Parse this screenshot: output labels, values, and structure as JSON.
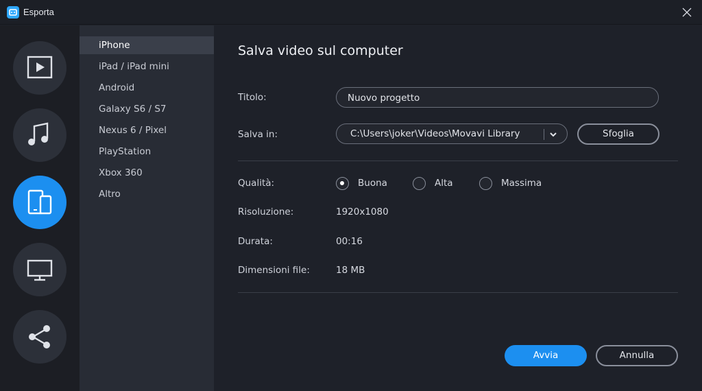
{
  "window": {
    "title": "Esporta"
  },
  "rail": {
    "items": [
      "video-icon",
      "music-icon",
      "devices-icon",
      "monitor-icon",
      "share-icon"
    ],
    "active": "devices-icon",
    "accent": "#1c8ff0"
  },
  "devices": {
    "items": [
      "iPhone",
      "iPad / iPad mini",
      "Android",
      "Galaxy S6 / S7",
      "Nexus 6 / Pixel",
      "PlayStation",
      "Xbox 360",
      "Altro"
    ],
    "selected": "iPhone"
  },
  "main": {
    "heading": "Salva video sul computer",
    "title_label": "Titolo:",
    "title_value": "Nuovo progetto",
    "save_label": "Salva in:",
    "save_path": "C:\\Users\\joker\\Videos\\Movavi Library",
    "browse_label": "Sfoglia",
    "quality_label": "Qualità:",
    "quality_options": [
      "Buona",
      "Alta",
      "Massima"
    ],
    "quality_selected": "Buona",
    "resolution_label": "Risoluzione:",
    "resolution_value": "1920x1080",
    "duration_label": "Durata:",
    "duration_value": "00:16",
    "size_label": "Dimensioni file:",
    "size_value": "18 MB",
    "start_label": "Avvia",
    "cancel_label": "Annulla"
  }
}
